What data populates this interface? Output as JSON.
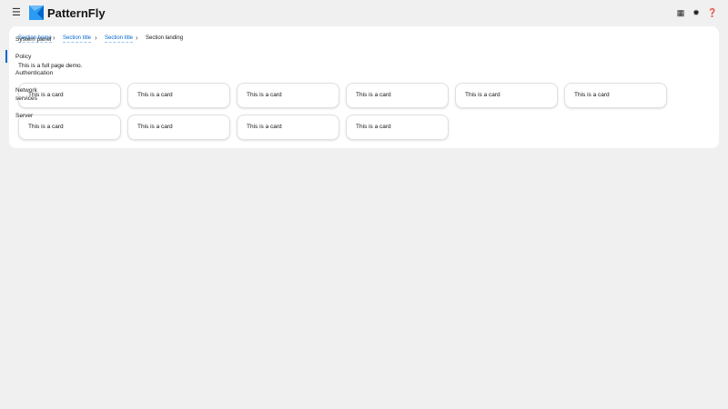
{
  "header": {
    "brand": "PatternFly",
    "icons": [
      "menu-icon",
      "grid-icon",
      "gear-icon",
      "help-icon"
    ]
  },
  "breadcrumb": [
    "Section home",
    "Section title",
    "Section title",
    "Section landing"
  ],
  "nav": {
    "items": [
      "System panel",
      "Policy",
      "Authentication",
      "Network services",
      "Server"
    ],
    "active": "Policy"
  },
  "main": {
    "description": "This is a full page demo.",
    "cards": [
      "This is a card",
      "This is a card",
      "This is a card",
      "This is a card",
      "This is a card",
      "This is a card",
      "This is a card",
      "This is a card",
      "This is a card",
      "This is a card"
    ]
  },
  "colors": {
    "accent": "#0066cc"
  }
}
